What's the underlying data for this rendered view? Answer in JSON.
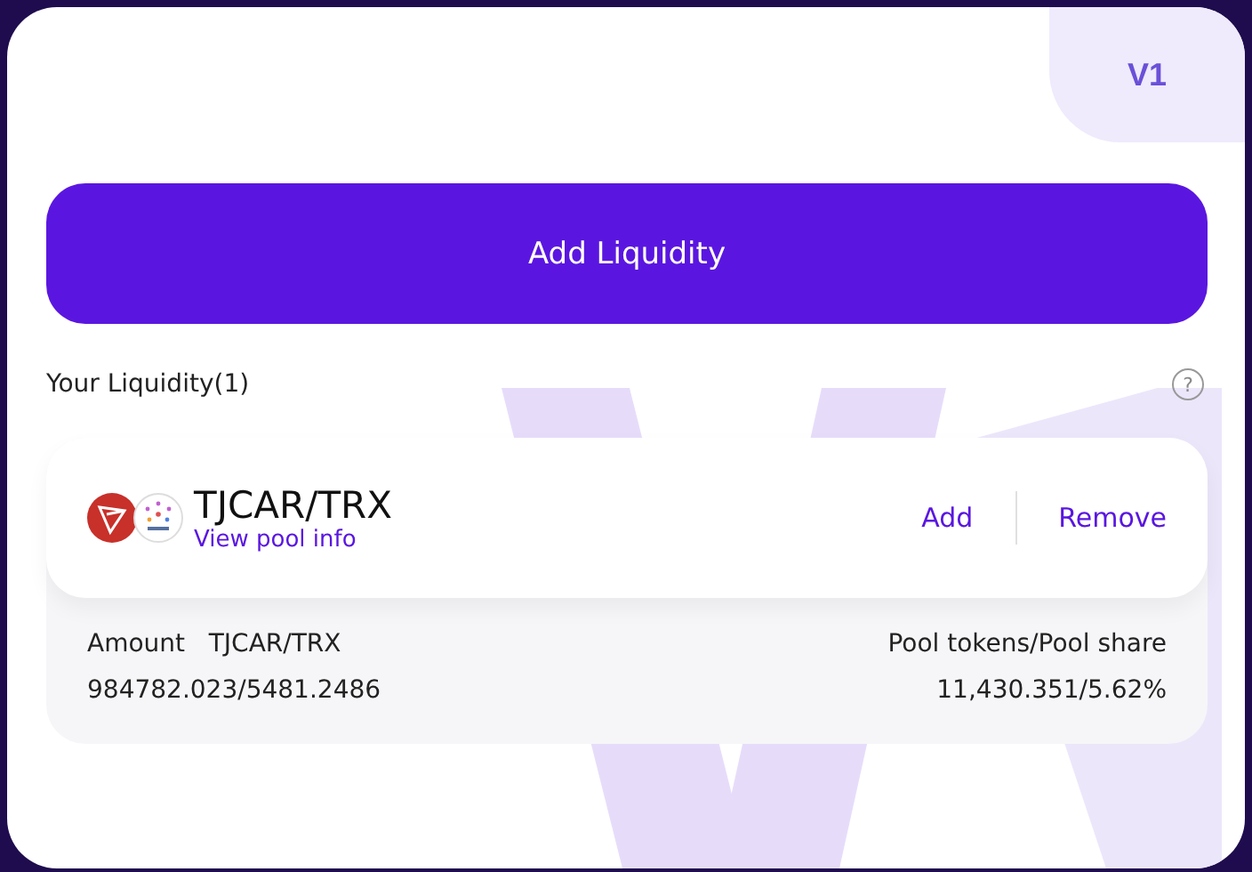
{
  "version_badge": "V1",
  "add_liquidity_button": "Add Liquidity",
  "your_liquidity": {
    "title": "Your Liquidity(1)",
    "help": "?"
  },
  "pools": [
    {
      "pair": "TJCAR/TRX",
      "info_link": "View pool info",
      "actions": [
        "Add",
        "Remove"
      ],
      "amount_label": "Amount",
      "amount_pair": "TJCAR/TRX",
      "amount_value": "984782.023/5481.2486",
      "share_label": "Pool tokens/Pool share",
      "share_value": "11,430.351/5.62%"
    }
  ]
}
